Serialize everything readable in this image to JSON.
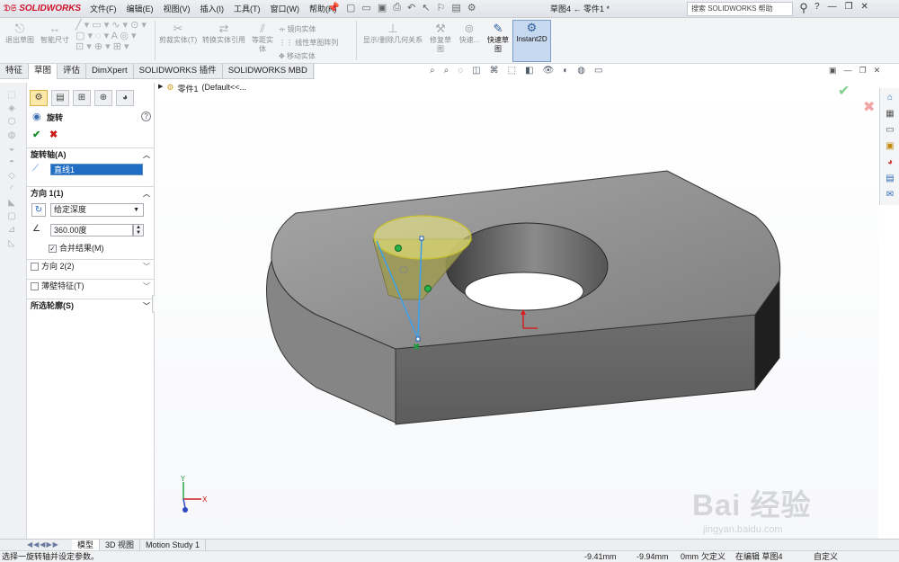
{
  "app": {
    "logo_text": "SOLIDWORKS",
    "menu": [
      "文件(F)",
      "编辑(E)",
      "视图(V)",
      "插入(I)",
      "工具(T)",
      "窗口(W)",
      "帮助(H)"
    ],
    "document_title": "草图4 ← 零件1 *",
    "help_search_placeholder": "搜索 SOLIDWORKS 帮助",
    "help_label": "?",
    "accent_color": "#d0112b"
  },
  "command_manager": {
    "exit_sketch": "退出草图",
    "smart_dimension": "智能尺寸",
    "trim_entities": "剪裁实体(T)",
    "convert_entities": "转换实体引用",
    "offset_entities_1": "等距实",
    "offset_entities_2": "体",
    "mirror_entities": "镜向实体",
    "linear_pattern": "线性草图阵列",
    "move_entities": "移动实体",
    "display_delete_relations": "显示/删除几何关系",
    "repair_sketch_1": "修复草",
    "repair_sketch_2": "图",
    "quick_snaps": "快速...",
    "rapid_sketch_1": "快速草",
    "rapid_sketch_2": "图",
    "instant2d": "Instant2D"
  },
  "tabs": [
    "特征",
    "草图",
    "评估",
    "DimXpert",
    "SOLIDWORKS 插件",
    "SOLIDWORKS MBD"
  ],
  "active_tab_index": 1,
  "property_manager": {
    "title": "旋转",
    "help": "?",
    "ok": "✔",
    "cancel": "✖",
    "axis_group": "旋转轴(A)",
    "axis_value": "直线1",
    "direction1_group": "方向 1(1)",
    "end_condition": "给定深度",
    "angle": "360.00度",
    "merge_result": "合并结果(M)",
    "direction2_group": "方向 2(2)",
    "thin_feature_group": "薄壁特征(T)",
    "selected_contours_group": "所选轮廓(S)"
  },
  "feature_tree": {
    "root": "零件1",
    "config": "(Default<<..."
  },
  "bottom_tabs": [
    "模型",
    "3D 视图",
    "Motion Study 1"
  ],
  "status": {
    "message": "选择一旋转轴并设定参数。",
    "x": "-9.41mm",
    "y": "-9.94mm",
    "z": "0mm",
    "definition": "欠定义",
    "editing": "在编辑 草图4",
    "units": "自定义"
  },
  "watermark": {
    "brand": "Bai 经验",
    "url": "jingyan.baidu.com"
  },
  "colors": {
    "sketch_blue": "#3ea0e8",
    "selection_yellow": "#e8e24a",
    "ok_green": "#1d8a2c",
    "cancel_red": "#c81b1b"
  }
}
